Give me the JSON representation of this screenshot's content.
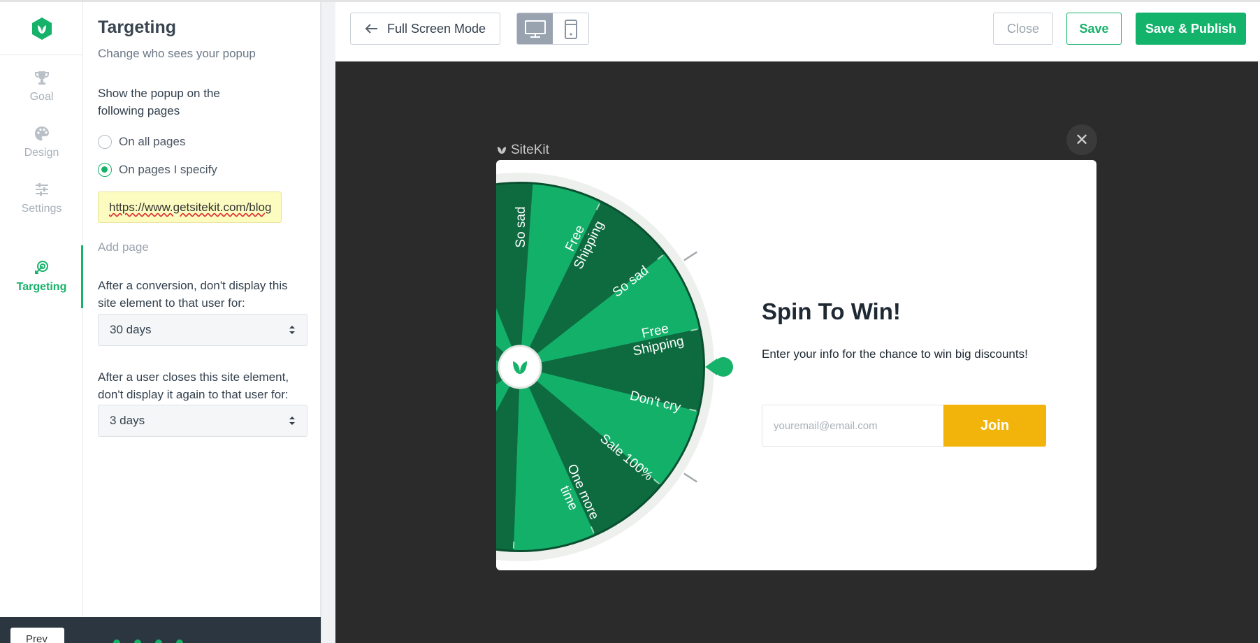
{
  "sidebar": {
    "items": [
      {
        "label": "Goal",
        "icon": "trophy-icon"
      },
      {
        "label": "Design",
        "icon": "palette-icon"
      },
      {
        "label": "Settings",
        "icon": "sliders-icon"
      },
      {
        "label": "Targeting",
        "icon": "target-icon",
        "active": true
      }
    ]
  },
  "targeting": {
    "title": "Targeting",
    "subtitle": "Change who sees your popup",
    "pages_question": "Show the popup on the following pages",
    "option_all": "On all pages",
    "option_specify": "On pages I specify",
    "selected_option": "On pages I specify",
    "url_value": "https://www.getsitekit.com/blog",
    "add_page": "Add page",
    "conversion_question": "After a conversion, don't display this site element to that user for:",
    "conversion_value": "30 days",
    "close_question": "After a user closes this site element, don't display it again to that user for:",
    "close_value": "3 days"
  },
  "footer": {
    "prev_label": "Prev"
  },
  "toolbar": {
    "fullscreen_label": "Full Screen Mode",
    "close_label": "Close",
    "save_label": "Save",
    "publish_label": "Save & Publish",
    "active_device": "desktop"
  },
  "preview": {
    "brand": "SiteKit",
    "close_glyph": "✕",
    "wheel_segments": [
      "So sad",
      "Free Shipping",
      "So sad",
      "Free Shipping",
      "Don't cry",
      "Sale 100%",
      "One more time"
    ],
    "popup_title": "Spin To Win!",
    "popup_description": "Enter your info for the chance to win big discounts!",
    "email_placeholder": "youremail@email.com",
    "join_label": "Join"
  },
  "colors": {
    "accent": "#17b26a",
    "publish": "#14b36c",
    "join": "#f2b40a",
    "wheel_dark": "#0d6b3f",
    "wheel_light": "#13b06a",
    "preview_bg": "#2b2b2b"
  }
}
